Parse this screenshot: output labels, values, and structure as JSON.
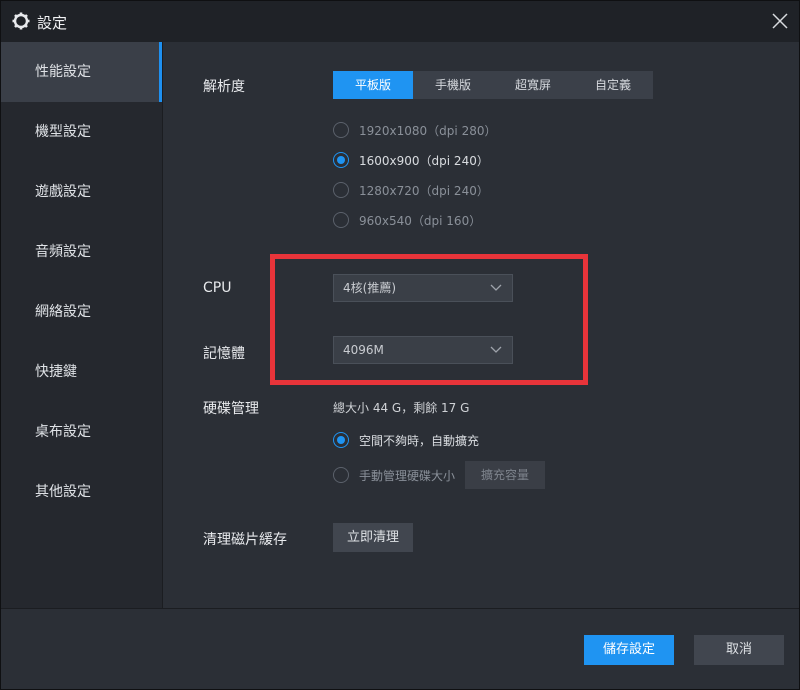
{
  "window": {
    "title": "設定"
  },
  "sidebar": {
    "items": [
      {
        "label": "性能設定",
        "active": true
      },
      {
        "label": "機型設定",
        "active": false
      },
      {
        "label": "遊戲設定",
        "active": false
      },
      {
        "label": "音頻設定",
        "active": false
      },
      {
        "label": "網絡設定",
        "active": false
      },
      {
        "label": "快捷鍵",
        "active": false
      },
      {
        "label": "桌布設定",
        "active": false
      },
      {
        "label": "其他設定",
        "active": false
      }
    ]
  },
  "resolution": {
    "label": "解析度",
    "tabs": [
      {
        "label": "平板版",
        "active": true
      },
      {
        "label": "手機版",
        "active": false
      },
      {
        "label": "超寬屏",
        "active": false
      },
      {
        "label": "自定義",
        "active": false
      }
    ],
    "options": [
      {
        "label": "1920x1080（dpi 280）",
        "checked": false
      },
      {
        "label": "1600x900（dpi 240）",
        "checked": true
      },
      {
        "label": "1280x720（dpi 240）",
        "checked": false
      },
      {
        "label": "960x540（dpi 160）",
        "checked": false
      }
    ]
  },
  "cpu": {
    "label": "CPU",
    "value": "4核(推薦)"
  },
  "memory": {
    "label": "記憶體",
    "value": "4096M"
  },
  "disk": {
    "label": "硬碟管理",
    "summary": "總大小 44 G，剩餘 17 G",
    "options": [
      {
        "label": "空間不夠時，自動擴充",
        "checked": true
      },
      {
        "label": "手動管理硬碟大小",
        "checked": false
      }
    ],
    "expand_button": "擴充容量"
  },
  "cache": {
    "label": "清理磁片緩存",
    "button": "立即清理"
  },
  "footer": {
    "save": "儲存設定",
    "cancel": "取消"
  },
  "colors": {
    "accent": "#1f94f2",
    "highlight": "#e8343a",
    "background": "#2b2f36",
    "sidebar": "#25282e",
    "titlebar": "#1f2227"
  },
  "icons": {
    "title": "gear-icon",
    "close": "close-icon",
    "dropdown": "chevron-down-icon"
  }
}
